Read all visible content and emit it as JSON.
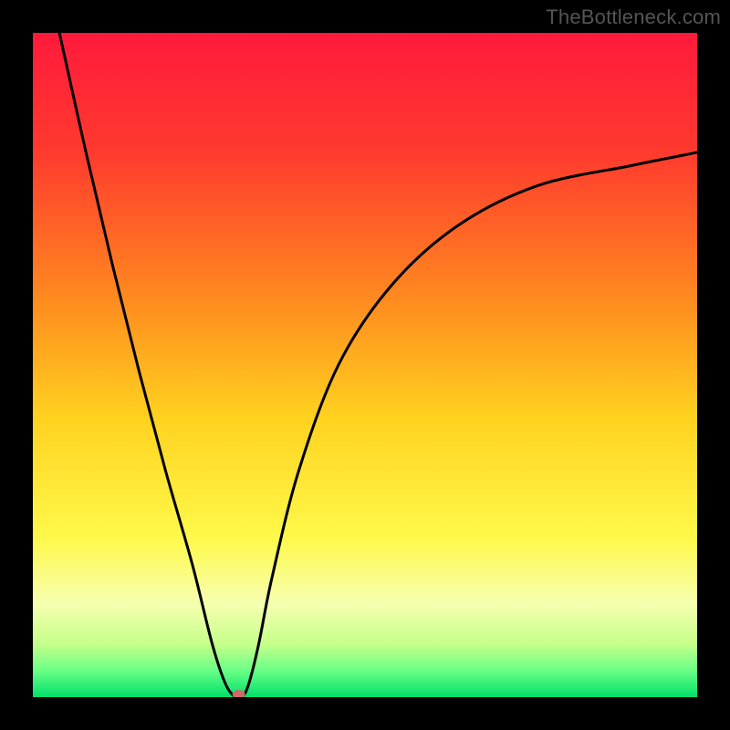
{
  "watermark": "TheBottleneck.com",
  "chart_data": {
    "type": "line",
    "title": "",
    "xlabel": "",
    "ylabel": "",
    "xlim": [
      0,
      100
    ],
    "ylim": [
      0,
      100
    ],
    "gradient_stops": [
      {
        "offset": 0.0,
        "color": "#ff1a3c"
      },
      {
        "offset": 0.18,
        "color": "#ff3a2e"
      },
      {
        "offset": 0.4,
        "color": "#ff8a1f"
      },
      {
        "offset": 0.58,
        "color": "#ffd21f"
      },
      {
        "offset": 0.76,
        "color": "#fff94a"
      },
      {
        "offset": 0.86,
        "color": "#f6ffb0"
      },
      {
        "offset": 0.92,
        "color": "#c6ff8a"
      },
      {
        "offset": 0.96,
        "color": "#6aff86"
      },
      {
        "offset": 1.0,
        "color": "#00e06a"
      }
    ],
    "series": [
      {
        "name": "bottleneck-curve",
        "x": [
          4,
          8,
          12,
          16,
          20,
          24,
          27,
          29,
          30.5,
          31.5,
          32.5,
          34,
          36,
          40,
          46,
          54,
          64,
          76,
          90,
          100
        ],
        "y": [
          100,
          82,
          65,
          49,
          34,
          20,
          8,
          2,
          0,
          0,
          2,
          8,
          18,
          34,
          50,
          62,
          71,
          77,
          80,
          82
        ]
      }
    ],
    "marker": {
      "x": 31,
      "y": 0,
      "color": "#d06a6a",
      "rx": 7,
      "ry": 5
    }
  }
}
